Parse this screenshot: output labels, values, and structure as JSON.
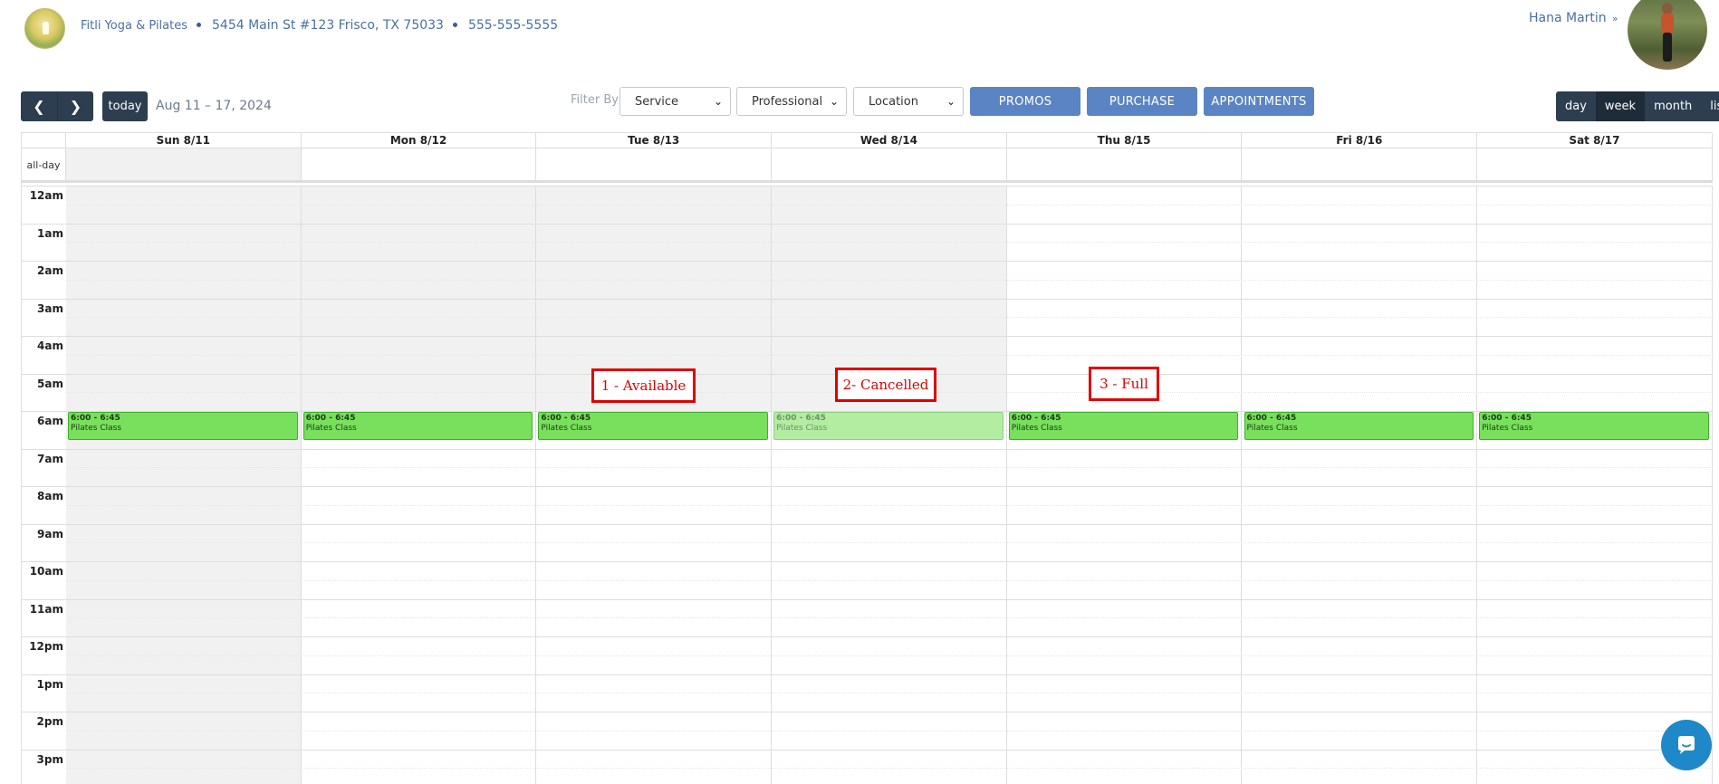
{
  "header": {
    "business_name": "Fitli Yoga & Pilates",
    "address": "5454 Main St #123 Frisco, TX 75033",
    "phone": "555-555-5555",
    "user_name": "Hana Martin",
    "user_menu_icon": "double-chevron-down-icon"
  },
  "toolbar": {
    "prev_icon": "chevron-left-icon",
    "next_icon": "chevron-right-icon",
    "prev_glyph": "❮",
    "next_glyph": "❯",
    "today_label": "today",
    "date_range": "Aug 11 – 17, 2024",
    "filter_label": "Filter By",
    "selects": [
      {
        "selected": "Service"
      },
      {
        "selected": "Professional"
      },
      {
        "selected": "Location"
      }
    ],
    "buttons": {
      "promos": "PROMOS",
      "purchase": "PURCHASE",
      "appointments": "APPOINTMENTS"
    },
    "views": [
      {
        "label": "day",
        "active": false
      },
      {
        "label": "week",
        "active": true
      },
      {
        "label": "month",
        "active": false
      },
      {
        "label": "list",
        "active": false
      }
    ]
  },
  "calendar": {
    "allday_label": "all-day",
    "days": [
      "Sun 8/11",
      "Mon 8/12",
      "Tue 8/13",
      "Wed 8/14",
      "Thu 8/15",
      "Fri 8/16",
      "Sat 8/17"
    ],
    "hours": [
      "12am",
      "1am",
      "2am",
      "3am",
      "4am",
      "5am",
      "6am",
      "7am",
      "8am",
      "9am",
      "10am",
      "11am",
      "12pm",
      "1pm",
      "2pm",
      "3pm"
    ],
    "events": [
      {
        "day": "Sun 8/11",
        "time": "6:00 - 6:45",
        "title": "Pilates Class",
        "state": "normal"
      },
      {
        "day": "Mon 8/12",
        "time": "6:00 - 6:45",
        "title": "Pilates Class",
        "state": "normal"
      },
      {
        "day": "Tue 8/13",
        "time": "6:00 - 6:45",
        "title": "Pilates Class",
        "state": "normal"
      },
      {
        "day": "Wed 8/14",
        "time": "6:00 - 6:45",
        "title": "Pilates Class",
        "state": "dimmed"
      },
      {
        "day": "Thu 8/15",
        "time": "6:00 - 6:45",
        "title": "Pilates Class",
        "state": "normal"
      },
      {
        "day": "Fri 8/16",
        "time": "6:00 - 6:45",
        "title": "Pilates Class",
        "state": "normal"
      },
      {
        "day": "Sat 8/17",
        "time": "6:00 - 6:45",
        "title": "Pilates Class",
        "state": "normal"
      }
    ]
  },
  "annotations": [
    "1 - Available",
    "2- Cancelled",
    "3 - Full"
  ],
  "colors": {
    "event_green": "#78e05c",
    "event_dimmed": "#b2eda2",
    "nav_dark": "#2c3e50",
    "action_blue": "#5b84c4",
    "annotation_red": "#e00000"
  },
  "chat_icon": "chat-bubble-icon"
}
